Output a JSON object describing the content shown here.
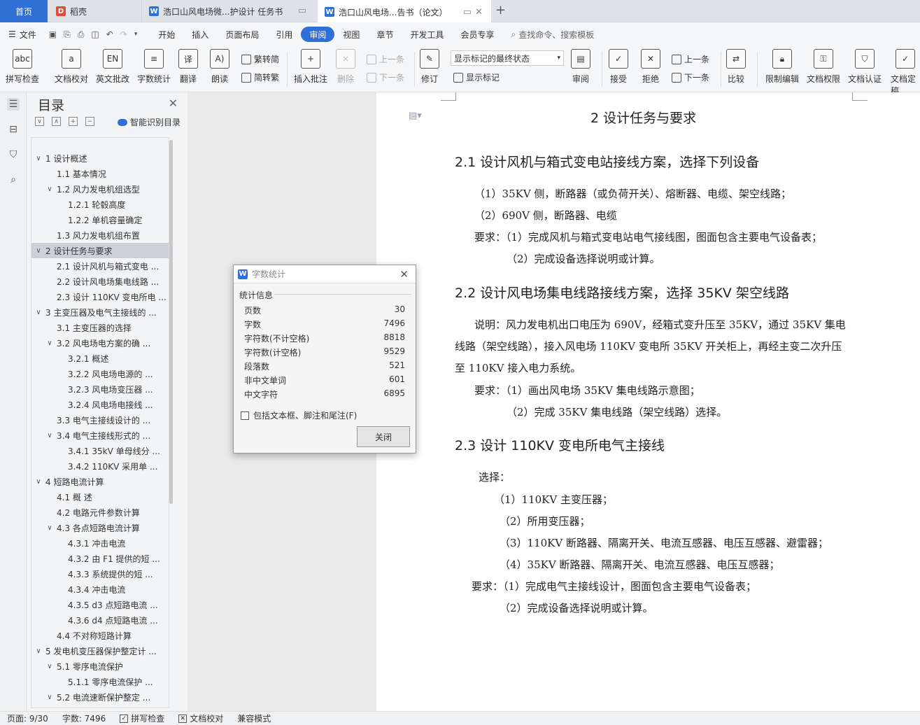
{
  "tabs": {
    "home": "首页",
    "daoke": "稻壳",
    "doc1": "浩口山风电场微...护设计 任务书",
    "doc2": "浩口山风电场...告书（论文）",
    "add": "+"
  },
  "menu": {
    "file": "文件",
    "items": [
      "开始",
      "插入",
      "页面布局",
      "引用",
      "审阅",
      "视图",
      "章节",
      "开发工具",
      "会员专享"
    ],
    "active": "审阅",
    "search": "查找命令、搜索模板"
  },
  "ribbon": {
    "spell": "拼写检查",
    "proof": "文档校对",
    "english": "英文批改",
    "wordcount": "字数统计",
    "translate": "翻译",
    "read": "朗读",
    "trad": "繁转简",
    "simp": "简转繁",
    "insert_comment": "插入批注",
    "delete": "删除",
    "prev": "上一条",
    "next": "下一条",
    "track": "修订",
    "markup_select": "显示标记的最终状态",
    "show_markup": "显示标记",
    "review": "审阅",
    "accept": "接受",
    "reject": "拒绝",
    "prev2": "上一条",
    "next2": "下一条",
    "compare": "比较",
    "restrict": "限制编辑",
    "perm": "文档权限",
    "cert": "文档认证",
    "final": "文档定稿"
  },
  "toc": {
    "title": "目录",
    "smart": "智能识别目录",
    "items": [
      {
        "t": "1   设计概述",
        "lv": 0,
        "car": "∨"
      },
      {
        "t": "1.1   基本情况",
        "lv": 1,
        "car": ""
      },
      {
        "t": "1.2   风力发电机组选型",
        "lv": 1,
        "car": "∨"
      },
      {
        "t": "1.2.1   轮毂高度",
        "lv": 2,
        "car": ""
      },
      {
        "t": "1.2.2   单机容量确定",
        "lv": 2,
        "car": ""
      },
      {
        "t": "1.3   风力发电机组布置",
        "lv": 1,
        "car": ""
      },
      {
        "t": "2   设计任务与要求",
        "lv": 0,
        "car": "∨",
        "sel": true
      },
      {
        "t": "2.1 设计风机与箱式变电 ...",
        "lv": 1,
        "car": ""
      },
      {
        "t": "2.2 设计风电场集电线路 ...",
        "lv": 1,
        "car": ""
      },
      {
        "t": "2.3 设计 110KV 变电所电 ...",
        "lv": 1,
        "car": ""
      },
      {
        "t": "3   主变压器及电气主接线的 ...",
        "lv": 0,
        "car": "∨"
      },
      {
        "t": "3.1   主变压器的选择",
        "lv": 1,
        "car": ""
      },
      {
        "t": "3.2   风电场电方案的确 ...",
        "lv": 1,
        "car": "∨"
      },
      {
        "t": "3.2.1   概述",
        "lv": 2,
        "car": ""
      },
      {
        "t": "3.2.2   风电场电源的 ...",
        "lv": 2,
        "car": ""
      },
      {
        "t": "3.2.3   风电场变压器 ...",
        "lv": 2,
        "car": ""
      },
      {
        "t": "3.2.4   风电场电接线 ...",
        "lv": 2,
        "car": ""
      },
      {
        "t": "3.3   电气主接线设计的 ...",
        "lv": 1,
        "car": ""
      },
      {
        "t": "3.4   电气主接线形式的 ...",
        "lv": 1,
        "car": "∨"
      },
      {
        "t": "3.4.1   35kV 单母线分 ...",
        "lv": 2,
        "car": ""
      },
      {
        "t": "3.4.2   110KV 采用单 ...",
        "lv": 2,
        "car": ""
      },
      {
        "t": "4  短路电流计算",
        "lv": 0,
        "car": "∨"
      },
      {
        "t": "4.1   概  述",
        "lv": 1,
        "car": ""
      },
      {
        "t": "4.2   电路元件参数计算",
        "lv": 1,
        "car": ""
      },
      {
        "t": "4.3   各点短路电流计算",
        "lv": 1,
        "car": "∨"
      },
      {
        "t": "4.3.1   冲击电流",
        "lv": 2,
        "car": ""
      },
      {
        "t": "4.3.2   由 F1 提供的短 ...",
        "lv": 2,
        "car": ""
      },
      {
        "t": "4.3.3   系统提供的短 ...",
        "lv": 2,
        "car": ""
      },
      {
        "t": "4.3.4   冲击电流",
        "lv": 2,
        "car": ""
      },
      {
        "t": "4.3.5   d3 点短路电流 ...",
        "lv": 2,
        "car": ""
      },
      {
        "t": "4.3.6   d4 点短路电流 ...",
        "lv": 2,
        "car": ""
      },
      {
        "t": "4.4   不对称短路计算",
        "lv": 1,
        "car": ""
      },
      {
        "t": "5   发电机变压器保护整定计 ...",
        "lv": 0,
        "car": "∨"
      },
      {
        "t": "5.1   零序电流保护",
        "lv": 1,
        "car": "∨"
      },
      {
        "t": "5.1.1   零序电流保护 ...",
        "lv": 2,
        "car": ""
      },
      {
        "t": "5.2   电流速断保护整定 ...",
        "lv": 1,
        "car": "∨"
      }
    ]
  },
  "doc": {
    "title": "2   设计任务与要求",
    "h21": "2.1 设计风机与箱式变电站接线方案，选择下列设备",
    "p1": "（1）35KV 侧，断路器（或负荷开关）、熔断器、电缆、架空线路；",
    "p2": "（2）690V 侧，断路器、电缆",
    "p3": "要求：（1）完成风机与箱式变电站电气接线图，图面包含主要电气设备表；",
    "p4": "（2）完成设备选择说明或计算。",
    "h22": "2.2 设计风电场集电线路接线方案，选择 35KV 架空线路",
    "p5": "说明：风力发电机出口电压为 690V，经箱式变升压至 35KV，通过 35KV 集电",
    "p6": "线路（架空线路），接入风电场 110KV 变电所 35KV 开关柜上，再经主变二次升压",
    "p7": "至 110KV 接入电力系统。",
    "p8": "要求：（1）画出风电场 35KV 集电线路示意图；",
    "p9": "（2）完成 35KV 集电线路（架空线路）选择。",
    "h23": "2.3 设计 110KV 变电所电气主接线",
    "p10": "选择：",
    "p11": "（1）110KV 主变压器；",
    "p12": "（2）所用变压器；",
    "p13": "（3）110KV 断路器、隔离开关、电流互感器、电压互感器、避雷器；",
    "p14": "（4）35KV 断路器、隔离开关、电流互感器、电压互感器；",
    "p15": "要求：（1）完成电气主接线设计，图面包含主要电气设备表；",
    "p16": "（2）完成设备选择说明或计算。"
  },
  "dialog": {
    "title": "字数统计",
    "section": "统计信息",
    "rows": [
      {
        "k": "页数",
        "v": "30"
      },
      {
        "k": "字数",
        "v": "7496"
      },
      {
        "k": "字符数(不计空格)",
        "v": "8818"
      },
      {
        "k": "字符数(计空格)",
        "v": "9529"
      },
      {
        "k": "段落数",
        "v": "521"
      },
      {
        "k": "非中文单词",
        "v": "601"
      },
      {
        "k": "中文字符",
        "v": "6895"
      }
    ],
    "checkbox": "包括文本框、脚注和尾注(F)",
    "close": "关闭"
  },
  "status": {
    "page": "页面: 9/30",
    "words": "字数: 7496",
    "spell": "拼写检查",
    "proof": "文档校对",
    "compat": "兼容模式"
  }
}
